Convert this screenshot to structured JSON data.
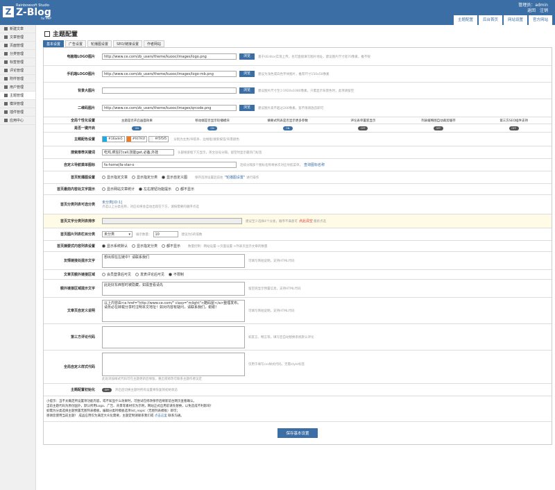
{
  "brand": {
    "studio": "Rainbowsoft Studio",
    "name": "Z-Blog",
    "php": "for PHP",
    "logo_letter": "Z"
  },
  "user": {
    "label": "管理员：admin",
    "home": "返回",
    "logout": "注销"
  },
  "topnav": [
    "主题配置",
    "后台首页",
    "网站设置",
    "官方网站"
  ],
  "sidebar": [
    "新建文章",
    "文章管理",
    "页面管理",
    "分类管理",
    "标签管理",
    "评论管理",
    "附件管理",
    "用户管理",
    "主题管理",
    "模块管理",
    "插件管理",
    "应用中心"
  ],
  "page": {
    "title": "主题配置"
  },
  "tabs": [
    "基本设置",
    "广告设置",
    "轮播图设置",
    "SEO/链接设置",
    "作者网站"
  ],
  "images": [
    {
      "label": "电脑端LOGO图片",
      "value": "http://www.ce.com/zb_users/theme/kuooc/images/logo.png",
      "btn": "浏览",
      "hint": "基于UEditor实现上传，也可直接填写图片地址，建议图片尺寸宽70像素，推不限"
    },
    {
      "label": "手机端LOGO图片",
      "value": "http://www.ce.com/zb_users/theme/kuooc/images/logo-mb.png",
      "btn": "浏览",
      "hint": "建议为浅色或白色字体图片，推荐尺寸150x50像素"
    },
    {
      "label": "背景大图片",
      "value": "",
      "btn": "浏览",
      "hint": "建议图片尺寸至少1920x1080像素，只需显示背景色时，此项请留空"
    },
    {
      "label": "二维码图片",
      "value": "http://www.ce.com/zb_users/theme/kuooc/images/qrcode.png",
      "btn": "浏览",
      "hint": "建议图片高不超过200像素，宽不限请放首即可"
    }
  ],
  "personal": {
    "label": "全局个性化设置",
    "cols": [
      "主题是否开启画面效果",
      "移动端是否显示轮播模块",
      "摘要式列表是否显示更多参数",
      "评论表单置底显示",
      "列表缓略图自动裁剪缓存",
      "第三方SEO插件支持"
    ]
  },
  "onekey": {
    "label": "是否一键开启",
    "states": [
      "ON",
      "ON",
      "ON",
      "OFF",
      "OFF",
      "OFF"
    ]
  },
  "colors": {
    "label": "主题配色设置",
    "items": [
      {
        "hex": "#16ade5",
        "code": "#16ade5"
      },
      {
        "hex": "#f4791f",
        "code": "#f4791f"
      },
      {
        "hex": "#f5f5f5",
        "code": "#f5f5f5"
      }
    ],
    "hint": "分别为主色/导航条、边线框/搜索按钮/背景颜色"
  },
  "hot": {
    "label": "搜索推荐关键词",
    "value": "吃鸡,疯狂打call,技能get,必备,外挂",
    "hint": "头部搜索框下方显示，英文逗号分隔，留空时显示最热门标签"
  },
  "menu": {
    "label": "自定义导航菜单图标",
    "value": "fa-home|fa-star-o",
    "hint": "连续分隔多个图标名称将依次对应导航菜单，",
    "link": "查询图标名称"
  },
  "slider": {
    "label": "首页轮播图设置",
    "opts": [
      "显示指定文章",
      "显示指定分类",
      "显示自定义图"
    ],
    "on": 2,
    "hint": "保存选项设置后前往",
    "link": "\"轮播图设置\"",
    "hint2": "进行操作"
  },
  "index": {
    "label": "首页最前内容处文字提示",
    "opts": [
      "显示网站文章统计",
      "左右按钮功能提示",
      "都不显示"
    ],
    "on": 1
  },
  "cats": {
    "label": "首页分类列表可选分类",
    "item": "未分类[ID:1]",
    "hint": "点选以上分类名称，对应ID将会自动出现在下方，请按需要的顺序点选"
  },
  "catsort": {
    "label": "首页文字分类列表排序",
    "hint": "建议至少选择4个分类，顺序不满意可",
    "link": "点此清空",
    "hint2": "重新点选"
  },
  "piccat": {
    "label": "首页图片列表栏目分类",
    "value": "未分类",
    "numlabel": "展示数量：",
    "num": "10",
    "hint": "建议为5的倍数"
  },
  "abstract": {
    "label": "首页摘要式内容列表设置",
    "opts": [
      "显示系统默认",
      "显示指定分类",
      "都不显示"
    ],
    "on": 0,
    "hint": "数量控制：网站设置->页面设置->列表页显示文章的数量"
  },
  "friend": {
    "label": "友情链接处提示文字",
    "value": "想出现在左链中？请联系我们",
    "hint": "可填写简短说明，支持HTML代码"
  },
  "area": {
    "label": "文章页额外链接区域",
    "opts": [
      "会员登录后可见",
      "发表评论后可见",
      "不限制"
    ],
    "on": 2
  },
  "extra": {
    "label": "额外链接区域提示文字",
    "value": "此处好东西暂时被隐藏，如需查看请先",
    "hint": "留空则显示预置信息，支持HTML代码"
  },
  "copyright": {
    "label": "文章页自定义说明",
    "value": "以上内容由<a href=\"http://www.ce.com/\" class=\"mlight\">酷码屋</a>整理发布。请务必在转载分享时注明本文地址！如对内容有疑问，请联系我们，谢谢！",
    "hint": "可填写简短说明，支持HTML代码"
  },
  "third": {
    "label": "第三方评论代码",
    "value": "",
    "hint": "如友言、畅言等，填写后自动替换系统默认评论"
  },
  "css": {
    "label": "全局自定义样式代码",
    "value": "",
    "hint": "仅用于填写css样式代码，无需style标签",
    "sub": "此处添加样式代码可在主题更新后保留，重启或修改可联系主题作者议定"
  },
  "init": {
    "label": "主题配置初始化",
    "state": "OFF",
    "hint": "开启后切换主题时所有设置将恢复到初始状态"
  },
  "notes": {
    "l1": "小提示：当不太确定所设置项功能内容，或不知显什么效果时，可尝试在修改保存后刷新前台网页查看确认。",
    "l2": "当前主题代码为原创国外，默认所用Logo、广告、背景等素材仅为示例，网站正式启用前请先替换，以免造成不利影响！",
    "l3": "如需为分类选择主题预置无图列表模板，编辑分类时模板选项list_nopic（无图列表模板）即可；",
    "l4a": "感谢您使用当前主题！ 成品应用仅为满足大众化需要，主题定制请联系我们或 ",
    "l4link": "点击这里",
    "l4b": " 联系沟通。"
  },
  "save": "保存基本设置"
}
